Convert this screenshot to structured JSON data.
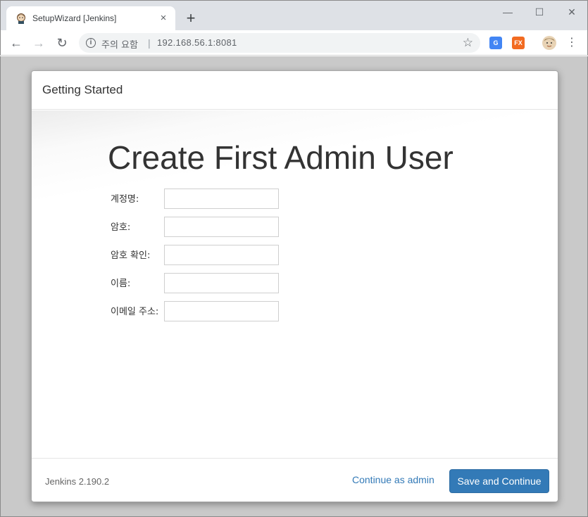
{
  "browser": {
    "tab_title": "SetupWizard [Jenkins]",
    "tab_close": "×",
    "new_tab": "+",
    "window_controls": {
      "minimize": "—",
      "maximize": "☐",
      "close": "✕"
    },
    "nav": {
      "back": "←",
      "forward": "→",
      "reload": "↻"
    },
    "omnibox": {
      "security_text": "주의 요함",
      "separator": "|",
      "url": "192.168.56.1:8081"
    },
    "extensions": [
      {
        "name": "translate-extension-icon",
        "label": "G",
        "color": "#4285f4"
      },
      {
        "name": "fx-extension-icon",
        "label": "FX",
        "color": "#f26b21"
      }
    ]
  },
  "dialog": {
    "header_title": "Getting Started",
    "heading": "Create First Admin User",
    "fields": [
      {
        "label": "계정명:",
        "value": ""
      },
      {
        "label": "암호:",
        "value": ""
      },
      {
        "label": "암호 확인:",
        "value": ""
      },
      {
        "label": "이름:",
        "value": ""
      },
      {
        "label": "이메일 주소:",
        "value": ""
      }
    ],
    "footer": {
      "version": "Jenkins 2.190.2",
      "continue_as_admin": "Continue as admin",
      "save_and_continue": "Save and Continue"
    }
  },
  "colors": {
    "primary_button": "#337ab7",
    "link": "#337ab7",
    "page_backdrop": "#c9c9c9"
  }
}
